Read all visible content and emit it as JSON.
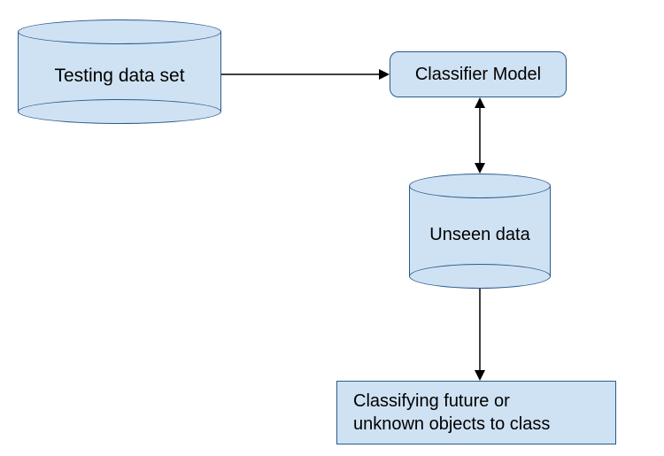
{
  "nodes": {
    "testing_data": {
      "label": "Testing data set"
    },
    "classifier_model": {
      "label": "Classifier Model"
    },
    "unseen_data": {
      "label": "Unseen data"
    },
    "classify_output": {
      "label_line1": "Classifying future or",
      "label_line2": "unknown objects to class"
    }
  },
  "colors": {
    "fill": "#cfe2f3",
    "stroke": "#2a5a8a",
    "arrow": "#000000"
  }
}
